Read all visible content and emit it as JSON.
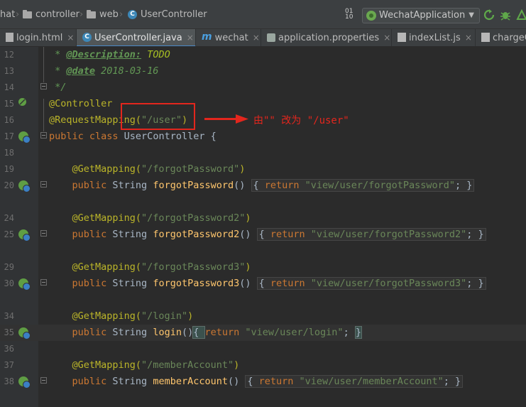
{
  "breadcrumb": {
    "item1": "hat",
    "item2": "controller",
    "item3": "web",
    "item4": "UserController",
    "class_icon_letter": "C"
  },
  "toolbar": {
    "run_config": "WechatApplication",
    "dropdown_glyph": "▼",
    "sort_glyph_top": "01",
    "sort_glyph_bottom": "10"
  },
  "tabs": [
    {
      "label": "login.html",
      "close": "×"
    },
    {
      "label": "UserController.java",
      "close": "×",
      "icon_letter": "C"
    },
    {
      "label": "wechat",
      "close": "×",
      "icon_letter": "m"
    },
    {
      "label": "application.properties",
      "close": "×"
    },
    {
      "label": "indexList.js",
      "close": "×"
    },
    {
      "label": "chargeC",
      "close": ""
    }
  ],
  "code_lines": [
    {
      "num": "12",
      "t1": " * ",
      "t2": "@Description:",
      "t3": " TODO"
    },
    {
      "num": "13",
      "t1": " * ",
      "t2": "@date",
      "t3": " 2018-03-16"
    },
    {
      "num": "14",
      "t1": " */"
    },
    {
      "num": "15",
      "t1": "@Controller"
    },
    {
      "num": "16",
      "t1": "@RequestMapping(",
      "t2": "\"/user\"",
      "t3": ")"
    },
    {
      "num": "17",
      "t1": "public class",
      "t2": " UserController {"
    },
    {
      "num": "18"
    },
    {
      "num": "19",
      "t1": "    @GetMapping(",
      "t2": "\"/forgotPassword\"",
      "t3": ")"
    },
    {
      "num": "20",
      "t1": "    public",
      "t2": " String ",
      "t3": "forgotPassword",
      "t4": "() ",
      "t5": "{ ",
      "t6": "return",
      "t7": " \"view/user/forgotPassword\"",
      "t8": "; }"
    },
    {
      "num": "24",
      "t1": "    @GetMapping(",
      "t2": "\"/forgotPassword2\"",
      "t3": ")"
    },
    {
      "num": "25",
      "t1": "    public",
      "t2": " String ",
      "t3": "forgotPassword2",
      "t4": "() ",
      "t5": "{ ",
      "t6": "return",
      "t7": " \"view/user/forgotPassword2\"",
      "t8": "; }"
    },
    {
      "num": "29",
      "t1": "    @GetMapping(",
      "t2": "\"/forgotPassword3\"",
      "t3": ")"
    },
    {
      "num": "30",
      "t1": "    public",
      "t2": " String ",
      "t3": "forgotPassword3",
      "t4": "() ",
      "t5": "{ ",
      "t6": "return",
      "t7": " \"view/user/forgotPassword3\"",
      "t8": "; }"
    },
    {
      "num": "34",
      "t1": "    @GetMapping(",
      "t2": "\"/login\"",
      "t3": ")"
    },
    {
      "num": "35",
      "t1": "    public",
      "t2": " String ",
      "t3": "login",
      "t4": "()",
      "t5": "{ ",
      "t6": "return",
      "t7": " \"view/user/login\"",
      "t8": "; ",
      "t9": "}"
    },
    {
      "num": "36"
    },
    {
      "num": "37",
      "t1": "    @GetMapping(",
      "t2": "\"/memberAccount\"",
      "t3": ")"
    },
    {
      "num": "38",
      "t1": "    public",
      "t2": " String ",
      "t3": "memberAccount",
      "t4": "() ",
      "t5": "{ ",
      "t6": "return",
      "t7": " \"view/user/memberAccount\"",
      "t8": "; }"
    }
  ],
  "annotation": {
    "note": "由\"\" 改为 \"/user\"",
    "color": "#e3261d"
  },
  "colors": {
    "background": "#2b2b2b",
    "keyword": "#cc7832",
    "string": "#6a8759",
    "annotation": "#bbb529",
    "method": "#ffc66d",
    "comment": "#629755"
  }
}
